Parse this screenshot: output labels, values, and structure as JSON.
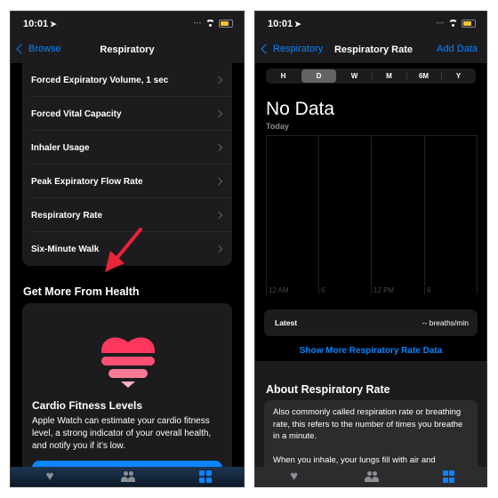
{
  "left": {
    "status": {
      "time": "10:01"
    },
    "nav": {
      "back_label": "Browse",
      "title": "Respiratory"
    },
    "list_items": [
      {
        "label": "Forced Expiratory Volume, 1 sec"
      },
      {
        "label": "Forced Vital Capacity"
      },
      {
        "label": "Inhaler Usage"
      },
      {
        "label": "Peak Expiratory Flow Rate"
      },
      {
        "label": "Respiratory Rate"
      },
      {
        "label": "Six-Minute Walk"
      }
    ],
    "section_title": "Get More From Health",
    "card": {
      "title": "Cardio Fitness Levels",
      "body": "Apple Watch can estimate your cardio fitness level, a strong indicator of your overall health, and notify you if it’s low."
    },
    "annotation": "red-arrow pointing to Respiratory Rate"
  },
  "right": {
    "status": {
      "time": "10:01"
    },
    "nav": {
      "back_label": "Respiratory",
      "title": "Respiratory Rate",
      "action_label": "Add Data"
    },
    "segments": [
      {
        "label": "H",
        "selected": false
      },
      {
        "label": "D",
        "selected": true
      },
      {
        "label": "W",
        "selected": false
      },
      {
        "label": "M",
        "selected": false
      },
      {
        "label": "6M",
        "selected": false
      },
      {
        "label": "Y",
        "selected": false
      }
    ],
    "headline": "No Data",
    "period": "Today",
    "x_labels": [
      "12 AM",
      "6",
      "12 PM",
      "6"
    ],
    "latest": {
      "label": "Latest",
      "value": "-- breaths/min"
    },
    "show_more": "Show More Respiratory Rate Data",
    "about": {
      "title": "About Respiratory Rate",
      "paragraphs": [
        "Also commonly called respiration rate or breathing rate, this refers to the number of times you breathe in a minute.",
        "When you inhale, your lungs fill with air and"
      ]
    }
  },
  "tabbar": {
    "tabs": [
      {
        "icon": "heart-icon",
        "name": "summary"
      },
      {
        "icon": "sharing-icon",
        "name": "sharing"
      },
      {
        "icon": "browse-grid-icon",
        "name": "browse",
        "active": true
      }
    ],
    "active_color": "#0a84ff",
    "inactive_color": "#8e8e93"
  },
  "colors": {
    "accent": "#0a84ff",
    "heart_top": "#ff375f",
    "arrow": "#e8233a"
  }
}
